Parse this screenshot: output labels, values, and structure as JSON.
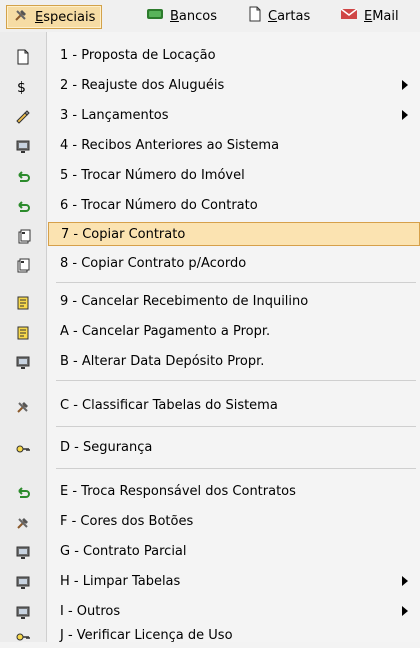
{
  "menubar": {
    "items": [
      {
        "label": "Especiais",
        "active": true,
        "icon": "hammer-tools-icon"
      },
      {
        "label": "Bancos",
        "active": false,
        "icon": "bank-icon"
      },
      {
        "label": "Cartas",
        "active": false,
        "icon": "document-icon"
      },
      {
        "label": "EMail",
        "active": false,
        "icon": "email-icon"
      }
    ]
  },
  "dropdown": {
    "items": [
      {
        "label": "1 - Proposta de Locação",
        "icon": "document-icon",
        "hasSubmenu": false
      },
      {
        "label": "2 - Reajuste dos Aluguéis",
        "icon": "money-icon",
        "hasSubmenu": true
      },
      {
        "label": "3 - Lançamentos",
        "icon": "pencil-icon",
        "hasSubmenu": true
      },
      {
        "label": "4 - Recibos Anteriores ao Sistema",
        "icon": "monitor-icon",
        "hasSubmenu": false
      },
      {
        "label": "5 - Trocar Número do Imóvel",
        "icon": "green-arrow-icon",
        "hasSubmenu": false
      },
      {
        "label": "6 - Trocar Número do Contrato",
        "icon": "green-arrow-icon",
        "hasSubmenu": false
      },
      {
        "label": "7 - Copiar Contrato",
        "icon": "copy-icon",
        "hasSubmenu": false,
        "selected": true
      },
      {
        "label": "8 - Copiar Contrato p/Acordo",
        "icon": "copy-icon",
        "hasSubmenu": false
      },
      {
        "label": "9 - Cancelar Recebimento de Inquilino",
        "icon": "cancel-receipt-icon",
        "hasSubmenu": false
      },
      {
        "label": "A - Cancelar Pagamento a Propr.",
        "icon": "cancel-payment-icon",
        "hasSubmenu": false
      },
      {
        "label": "B - Alterar Data Depósito Propr.",
        "icon": "monitor-icon",
        "hasSubmenu": false
      },
      {
        "label": "C - Classificar Tabelas do Sistema",
        "icon": "hammer-tools-icon",
        "hasSubmenu": false
      },
      {
        "label": "D - Segurança",
        "icon": "key-icon",
        "hasSubmenu": false
      },
      {
        "label": "E - Troca Responsável dos Contratos",
        "icon": "green-arrow-icon",
        "hasSubmenu": false
      },
      {
        "label": "F - Cores dos Botões",
        "icon": "hammer-tools-icon",
        "hasSubmenu": false
      },
      {
        "label": "G - Contrato Parcial",
        "icon": "monitor-icon",
        "hasSubmenu": false
      },
      {
        "label": "H - Limpar Tabelas",
        "icon": "monitor-icon",
        "hasSubmenu": true
      },
      {
        "label": "I - Outros",
        "icon": "monitor-icon",
        "hasSubmenu": true
      },
      {
        "label": "J - Verificar Licença de Uso",
        "icon": "key-icon",
        "hasSubmenu": false
      }
    ]
  },
  "colors": {
    "highlight": "#fbe3b1",
    "highlightBorder": "#d6a04a",
    "separator": "#cfcfcf"
  }
}
